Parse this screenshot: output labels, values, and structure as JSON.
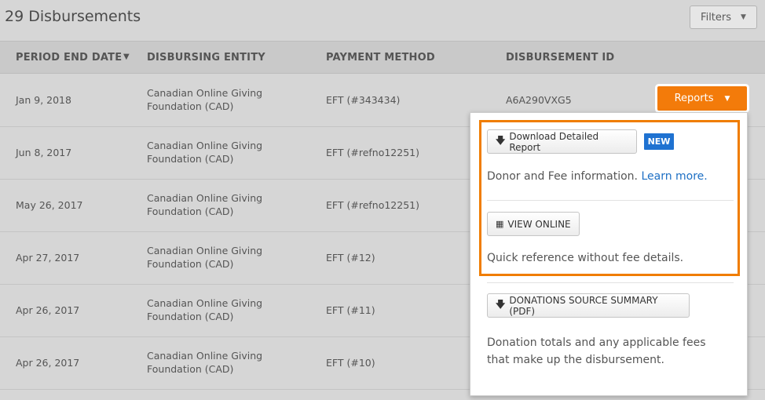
{
  "header": {
    "title": "29 Disbursements",
    "filters_label": "Filters"
  },
  "columns": [
    "PERIOD END DATE",
    "DISBURSING ENTITY",
    "PAYMENT METHOD",
    "DISBURSEMENT ID"
  ],
  "rows": [
    {
      "date": "Jan 9, 2018",
      "entity": "Canadian Online Giving Foundation (CAD)",
      "method": "EFT (#343434)",
      "id": "A6A290VXG5"
    },
    {
      "date": "Jun 8, 2017",
      "entity": "Canadian Online Giving Foundation (CAD)",
      "method": "EFT (#refno12251)",
      "id": ""
    },
    {
      "date": "May 26, 2017",
      "entity": "Canadian Online Giving Foundation (CAD)",
      "method": "EFT (#refno12251)",
      "id": ""
    },
    {
      "date": "Apr 27, 2017",
      "entity": "Canadian Online Giving Foundation (CAD)",
      "method": "EFT (#12)",
      "id": ""
    },
    {
      "date": "Apr 26, 2017",
      "entity": "Canadian Online Giving Foundation (CAD)",
      "method": "EFT (#11)",
      "id": ""
    },
    {
      "date": "Apr 26, 2017",
      "entity": "Canadian Online Giving Foundation (CAD)",
      "method": "EFT (#10)",
      "id": ""
    }
  ],
  "reports": {
    "button_label": "Reports",
    "download_label": "Download Detailed Report",
    "new_badge": "NEW",
    "download_desc": "Donor and Fee information.",
    "learn_more": "Learn more.",
    "view_online_label": "VIEW ONLINE",
    "view_online_desc": "Quick reference without fee details.",
    "summary_label": "DONATIONS SOURCE SUMMARY (PDF)",
    "summary_desc": "Donation totals and any applicable fees that make up the disbursement."
  },
  "colors": {
    "accent": "#f37b0a",
    "badge": "#1f72d1",
    "link": "#1d6fc4"
  },
  "icons": [
    "download-arrow-icon",
    "table-grid-icon",
    "sort-down-icon",
    "chevron-down-icon"
  ]
}
